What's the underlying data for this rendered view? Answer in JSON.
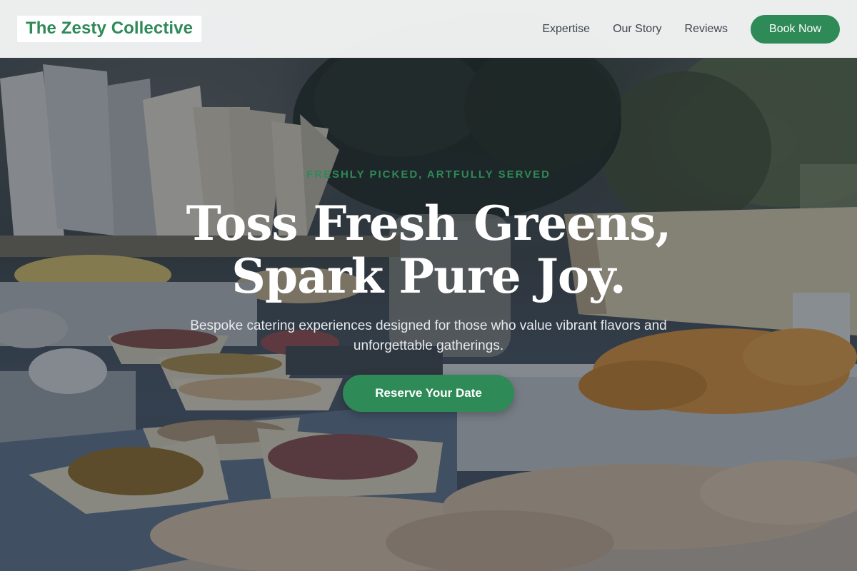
{
  "brand": {
    "name": "The Zesty Collective"
  },
  "nav": {
    "links": [
      {
        "label": "Expertise"
      },
      {
        "label": "Our Story"
      },
      {
        "label": "Reviews"
      }
    ],
    "cta_label": "Book Now"
  },
  "hero": {
    "eyebrow": "FRESHLY PICKED, ARTFULLY SERVED",
    "headline": "Toss Fresh Greens, Spark Pure Joy.",
    "subtext": "Bespoke catering experiences designed for those who value vibrant flavors and unforgettable gatherings.",
    "cta_label": "Reserve Your Date"
  },
  "colors": {
    "accent": "#2e8a57",
    "nav_background": "#f4f5f5",
    "nav_text": "#3f4650",
    "headline": "#ffffff"
  }
}
